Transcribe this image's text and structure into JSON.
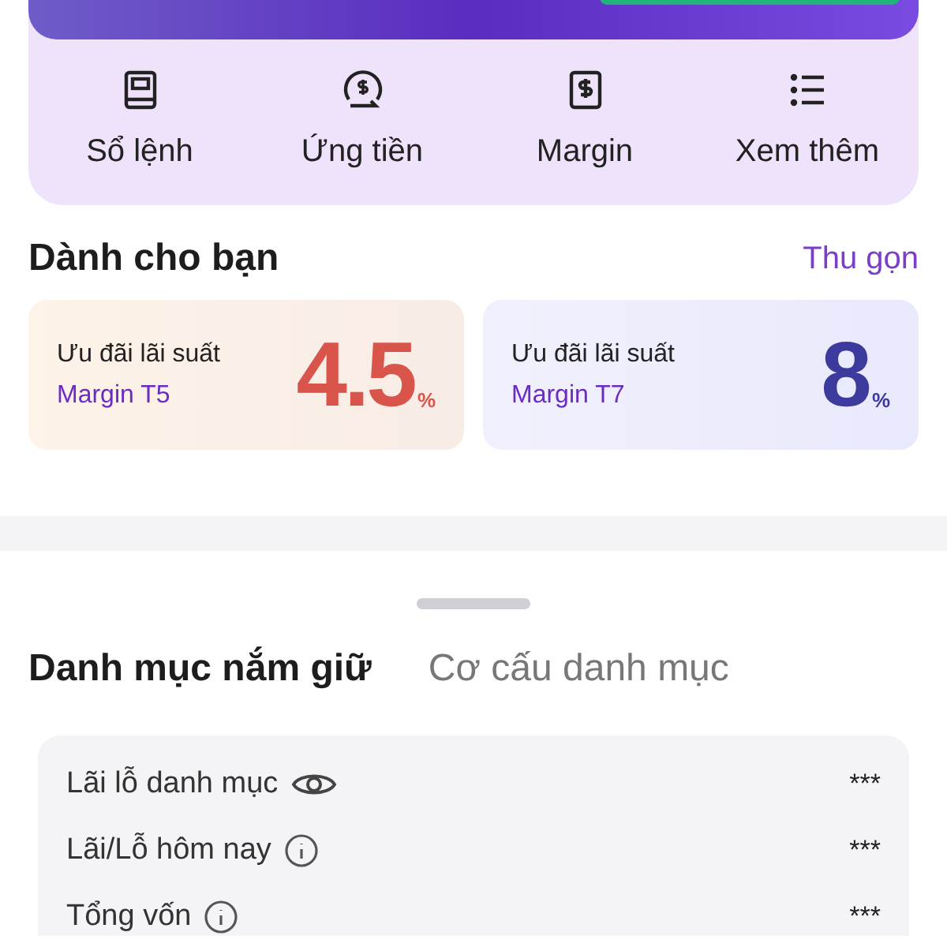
{
  "quick_actions": [
    {
      "label": "Sổ lệnh",
      "kind": "book"
    },
    {
      "label": "Ứng tiền",
      "kind": "advance"
    },
    {
      "label": "Margin",
      "kind": "margin"
    },
    {
      "label": "Xem thêm",
      "kind": "more"
    }
  ],
  "for_you": {
    "title": "Dành cho bạn",
    "action": "Thu gọn",
    "promos": [
      {
        "kind": "warm",
        "title": "Ưu đãi lãi suất",
        "subtitle": "Margin T5",
        "value": "4.5",
        "unit": "%"
      },
      {
        "kind": "cool",
        "title": "Ưu đãi lãi suất",
        "subtitle": "Margin T7",
        "value": "8",
        "unit": "%"
      }
    ]
  },
  "portfolio": {
    "tabs": [
      {
        "label": "Danh mục nắm giữ",
        "selected": true
      },
      {
        "label": "Cơ cấu danh mục",
        "selected": false
      }
    ],
    "rows": [
      {
        "label": "Lãi lỗ danh mục",
        "kind": "toggle",
        "value": "***"
      },
      {
        "label": "Lãi/Lỗ hôm nay",
        "kind": "help",
        "value": "***"
      },
      {
        "label": "Tổng vốn",
        "kind": "help",
        "value": "***"
      }
    ]
  }
}
